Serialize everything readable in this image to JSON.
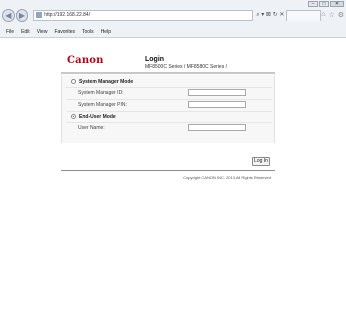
{
  "browser": {
    "url": "http://192.168.22.84/",
    "address_icons": "⌕ ▾ ⊠ ↻ ✕",
    "tab_label": "",
    "menu": [
      "File",
      "Edit",
      "View",
      "Favorites",
      "Tools",
      "Help"
    ]
  },
  "header": {
    "logo": "Canon",
    "title": "Login",
    "subtitle": "MF8500C Series / MF8580C Series /"
  },
  "form": {
    "system_manager_mode": "System Manager Mode",
    "system_manager_id_label": "System Manager ID:",
    "system_manager_pin_label": "System Manager PIN:",
    "end_user_mode": "End-User Mode",
    "user_name_label": "User Name:",
    "selected_mode": "End-User Mode"
  },
  "login_button": "Log In",
  "footer": "Copyright CANON INC. 2013 All Rights Reserved"
}
